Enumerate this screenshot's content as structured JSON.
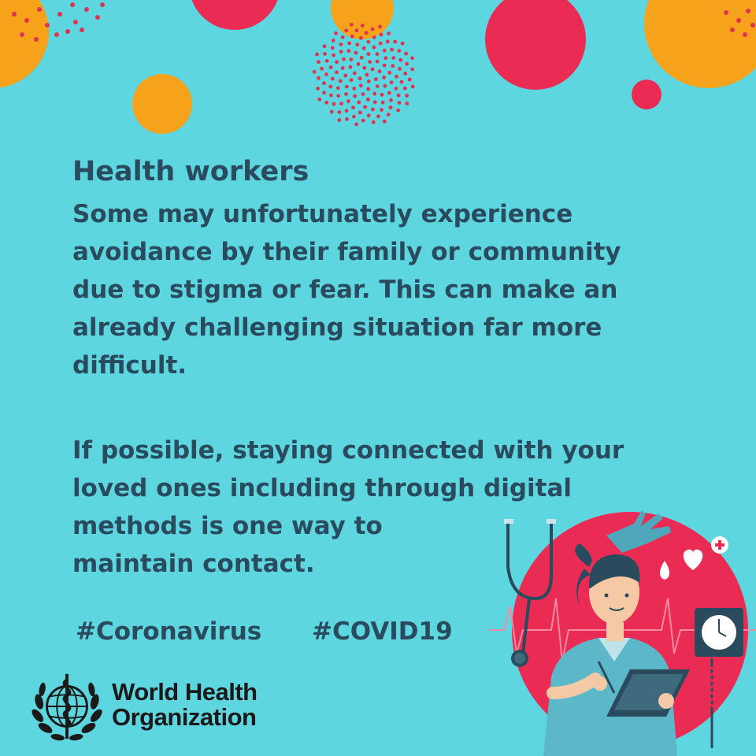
{
  "poster": {
    "title": "Health workers",
    "paragraph1": [
      "Some may unfortunately experience",
      "avoidance by their family or community",
      "due to stigma or fear. This can make an",
      "already challenging situation far more",
      "difficult."
    ],
    "paragraph2": [
      "If possible, staying connected with your",
      "loved ones including through digital",
      "methods is one way to",
      "maintain contact."
    ],
    "hashtags": [
      "#Coronavirus",
      "#COVID19"
    ],
    "organization": [
      "World Health",
      "Organization"
    ]
  },
  "colors": {
    "background": "#5ed6e0",
    "text": "#2a4b5e",
    "orange": "#f7a21b",
    "red": "#ea2c55",
    "dot_red": "#e0334f"
  },
  "icons": [
    "who-emblem-icon",
    "nurse-illustration",
    "stethoscope-icon",
    "heart-icon",
    "water-drop-icon",
    "medical-cross-icon",
    "blood-pressure-monitor-icon",
    "glove-icon",
    "clipboard-icon"
  ]
}
